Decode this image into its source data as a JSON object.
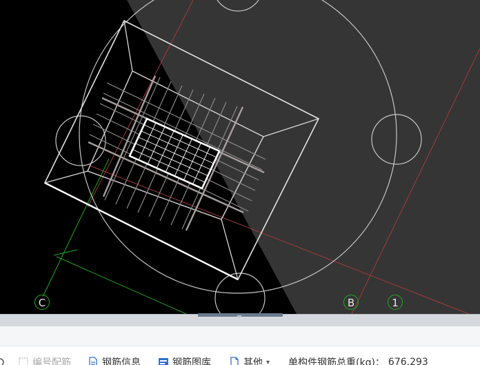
{
  "axis_labels": {
    "c": "C",
    "b": "B",
    "one": "1"
  },
  "toolbar": {
    "partial_left_icon": "gear-icon",
    "layout_label": "编号配筋",
    "rebar_info_label": "钢筋信息",
    "rebar_diagram_label": "钢筋图库",
    "other_label": "其他",
    "other_dropdown_icon": "chevron-down-icon",
    "total_weight_label": "单构件钢筋总重(kg)：",
    "total_weight_value": "676.293"
  },
  "colors": {
    "canvas_bg": "#000000",
    "floor_fill": "#353535",
    "axis_green": "#1faa1f",
    "axis_red": "#a33a3a",
    "wire": "#d8d8d8",
    "toolbar_icon_blue": "#2f6fd0"
  }
}
